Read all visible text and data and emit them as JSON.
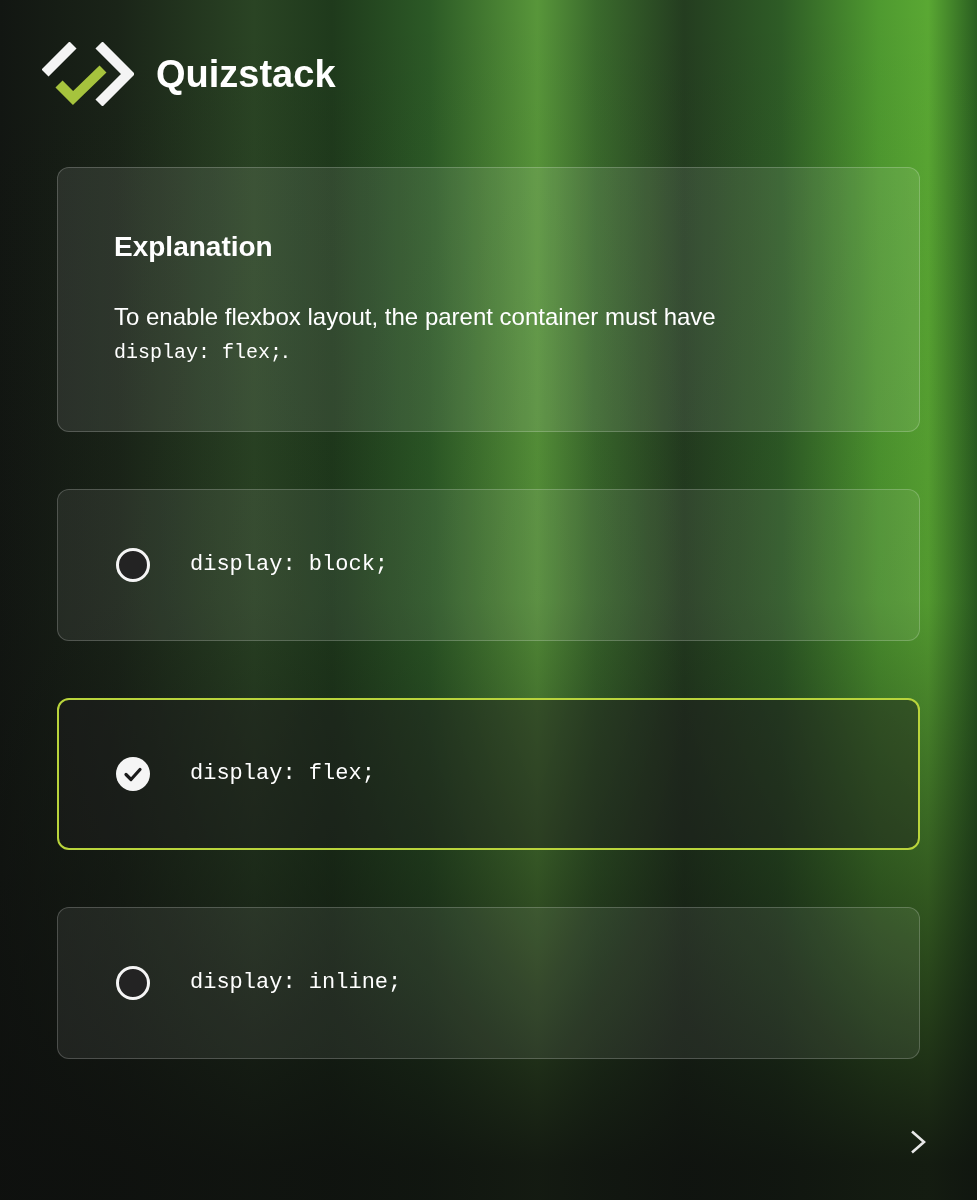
{
  "app": {
    "name": "Quizstack"
  },
  "explanation": {
    "title": "Explanation",
    "segments": [
      {
        "kind": "text",
        "text": "To enable flexbox layout, the parent container must have "
      },
      {
        "kind": "code",
        "text": "display: flex;"
      },
      {
        "kind": "text",
        "text": "."
      }
    ]
  },
  "options": [
    {
      "label": "display: block;",
      "selected": false
    },
    {
      "label": "display: flex;",
      "selected": true
    },
    {
      "label": "display: inline;",
      "selected": false
    }
  ]
}
